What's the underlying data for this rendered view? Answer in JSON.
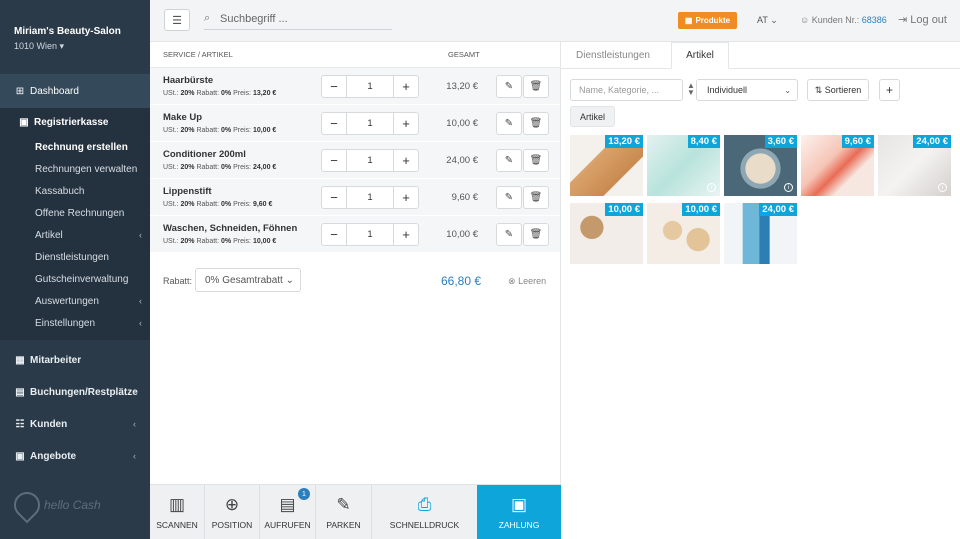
{
  "sidebar": {
    "salon_name": "Miriam's Beauty-Salon",
    "location": "1010 Wien",
    "dashboard": "Dashboard",
    "register": "Registrierkasse",
    "sub_items": [
      {
        "label": "Rechnung erstellen",
        "active": true,
        "chevron": false
      },
      {
        "label": "Rechnungen verwalten",
        "active": false,
        "chevron": false
      },
      {
        "label": "Kassabuch",
        "active": false,
        "chevron": false
      },
      {
        "label": "Offene Rechnungen",
        "active": false,
        "chevron": false
      },
      {
        "label": "Artikel",
        "active": false,
        "chevron": true
      },
      {
        "label": "Dienstleistungen",
        "active": false,
        "chevron": false
      },
      {
        "label": "Gutscheinverwaltung",
        "active": false,
        "chevron": false
      },
      {
        "label": "Auswertungen",
        "active": false,
        "chevron": true
      },
      {
        "label": "Einstellungen",
        "active": false,
        "chevron": true
      }
    ],
    "other_items": [
      {
        "label": "Mitarbeiter",
        "icon": "staff-icon",
        "chevron": false
      },
      {
        "label": "Buchungen/Restplätze",
        "icon": "calendar-icon",
        "chevron": true
      },
      {
        "label": "Kunden",
        "icon": "customers-icon",
        "chevron": true
      },
      {
        "label": "Angebote",
        "icon": "offers-icon",
        "chevron": true
      }
    ],
    "logo_text": "hello Cash"
  },
  "topbar": {
    "search_placeholder": "Suchbegriff ...",
    "products_label": "Produkte",
    "language": "AT",
    "customer_label": "Kunden Nr.:",
    "customer_number": "68386",
    "logout": "Log out"
  },
  "cart": {
    "col_service": "SERVICE / ARTIKEL",
    "col_total": "GESAMT",
    "items": [
      {
        "name": "Haarbürste",
        "ust": "20%",
        "rabatt": "0%",
        "preis": "13,20 €",
        "qty": "1",
        "total": "13,20 €"
      },
      {
        "name": "Make Up",
        "ust": "20%",
        "rabatt": "0%",
        "preis": "10,00 €",
        "qty": "1",
        "total": "10,00 €"
      },
      {
        "name": "Conditioner 200ml",
        "ust": "20%",
        "rabatt": "0%",
        "preis": "24,00 €",
        "qty": "1",
        "total": "24,00 €"
      },
      {
        "name": "Lippenstift",
        "ust": "20%",
        "rabatt": "0%",
        "preis": "9,60 €",
        "qty": "1",
        "total": "9,60 €"
      },
      {
        "name": "Waschen, Schneiden, Föhnen",
        "ust": "20%",
        "rabatt": "0%",
        "preis": "10,00 €",
        "qty": "1",
        "total": "10,00 €"
      }
    ],
    "meta_labels": {
      "ust": "USt.:",
      "rabatt": "Rabatt:",
      "preis": "Preis:"
    },
    "discount_label": "Rabatt:",
    "discount_value": "0% Gesamtrabatt",
    "grand_total": "66,80 €",
    "clear_label": "Leeren"
  },
  "toolbar": {
    "scan": "SCANNEN",
    "position": "POSITION",
    "recall": "AUFRUFEN",
    "recall_badge": "1",
    "park": "PARKEN",
    "quick_print": "SCHNELLDRUCK",
    "payment": "ZAHLUNG"
  },
  "catalog": {
    "tabs": [
      "Dienstleistungen",
      "Artikel"
    ],
    "active_tab": "Artikel",
    "filter_placeholder": "Name, Kategorie, ...",
    "sort_mode": "Individuell",
    "sort_button": "Sortieren",
    "chip": "Artikel",
    "products": [
      {
        "price": "13,20 €",
        "icon": "hairbrush-image",
        "info": false
      },
      {
        "price": "8,40 €",
        "icon": "toothbrush-image",
        "info": true
      },
      {
        "price": "3,60 €",
        "icon": "coffee-image",
        "info": true
      },
      {
        "price": "9,60 €",
        "icon": "lipstick-image",
        "info": false
      },
      {
        "price": "24,00 €",
        "icon": "hairdryer-image",
        "info": true
      },
      {
        "price": "10,00 €",
        "icon": "makeup-image",
        "info": false
      },
      {
        "price": "10,00 €",
        "icon": "pastry-image",
        "info": false
      },
      {
        "price": "24,00 €",
        "icon": "conditioner-image",
        "info": false
      }
    ]
  }
}
